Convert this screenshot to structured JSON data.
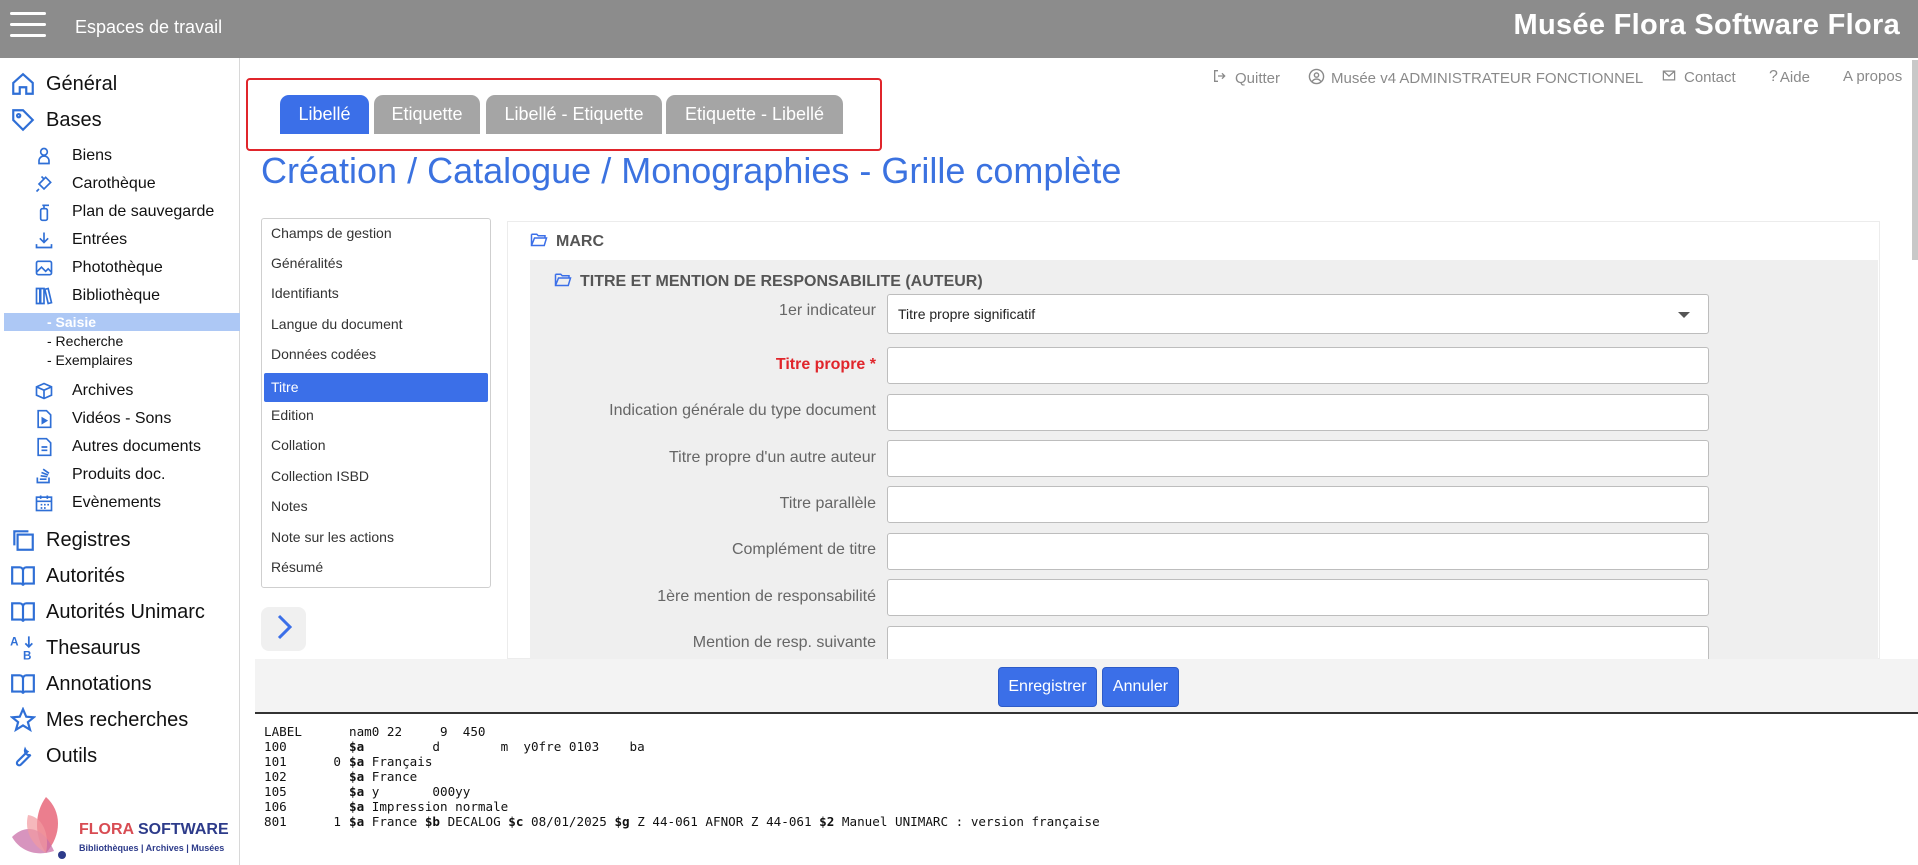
{
  "topbar": {
    "workspaces_label": "Espaces de travail",
    "app_title": "Musée Flora Software Flora"
  },
  "sidebar": {
    "main_items": [
      {
        "label": "Général",
        "icon": "home-icon"
      },
      {
        "label": "Bases",
        "icon": "tag-icon"
      },
      {
        "label": "Registres",
        "icon": "stack-icon"
      },
      {
        "label": "Autorités",
        "icon": "book-icon"
      },
      {
        "label": "Autorités Unimarc",
        "icon": "book-icon"
      },
      {
        "label": "Thesaurus",
        "icon": "az-sort-icon"
      },
      {
        "label": "Annotations",
        "icon": "book-icon"
      },
      {
        "label": "Mes recherches",
        "icon": "star-icon"
      },
      {
        "label": "Outils",
        "icon": "wrench-icon"
      }
    ],
    "sub_items": [
      {
        "label": "Biens",
        "icon": "bust-icon"
      },
      {
        "label": "Carothèque",
        "icon": "drill-icon"
      },
      {
        "label": "Plan de sauvegarde",
        "icon": "extinguisher-icon"
      },
      {
        "label": "Entrées",
        "icon": "download-icon"
      },
      {
        "label": "Photothèque",
        "icon": "image-icon"
      },
      {
        "label": "Bibliothèque",
        "icon": "books-icon"
      },
      {
        "label": "Archives",
        "icon": "box-icon"
      },
      {
        "label": "Vidéos - Sons",
        "icon": "video-file-icon"
      },
      {
        "label": "Autres documents",
        "icon": "document-icon"
      },
      {
        "label": "Produits doc.",
        "icon": "stack-overflow-icon"
      },
      {
        "label": "Evènements",
        "icon": "calendar-icon"
      }
    ],
    "library_leaves": [
      "- Saisie",
      "- Recherche",
      "- Exemplaires"
    ],
    "logo": {
      "brand_a": "FLORA",
      "brand_b": "SOFTWARE",
      "tagline": "Bibliothèques | Archives | Musées"
    }
  },
  "header_links": {
    "quit": "Quitter",
    "user": "Musée v4 ADMINISTRATEUR FONCTIONNEL",
    "contact": "Contact",
    "help": "Aide",
    "about": "A propos"
  },
  "tabs": [
    "Libellé",
    "Etiquette",
    "Libellé - Etiquette",
    "Etiquette - Libellé"
  ],
  "page_title": "Création / Catalogue / Monographies - Grille complète",
  "sections": [
    "Champs de gestion",
    "Généralités",
    "Identifiants",
    "Langue du document",
    "Données codées",
    "Titre",
    "Edition",
    "Collation",
    "Collection ISBD",
    "Notes",
    "Note sur les actions",
    "Résumé"
  ],
  "form": {
    "marc_header": "MARC",
    "section_header": "TITRE ET MENTION DE RESPONSABILITE (AUTEUR)",
    "indicator_label": "1er indicateur",
    "indicator_value": "Titre propre significatif",
    "fields": [
      {
        "label": "Titre propre *",
        "value": ""
      },
      {
        "label": "Indication générale du type document",
        "value": ""
      },
      {
        "label": "Titre propre d'un autre auteur",
        "value": ""
      },
      {
        "label": "Titre parallèle",
        "value": ""
      },
      {
        "label": "Complément de titre",
        "value": ""
      },
      {
        "label": "1ère mention de responsabilité",
        "value": ""
      },
      {
        "label": "Mention de resp. suivante",
        "value": ""
      }
    ]
  },
  "actions": {
    "save": "Enregistrer",
    "cancel": "Annuler"
  },
  "marc_output": [
    {
      "tag": "LABEL",
      "ind": "",
      "content": "nam0 22     9  450"
    },
    {
      "tag": "100",
      "ind": "",
      "content": "$a         d        m  y0fre 0103    ba"
    },
    {
      "tag": "101",
      "ind": "0",
      "content": "$a Français"
    },
    {
      "tag": "102",
      "ind": "",
      "content": "$a France"
    },
    {
      "tag": "105",
      "ind": "",
      "content": "$a y       000yy"
    },
    {
      "tag": "106",
      "ind": "",
      "content": "$a Impression normale"
    },
    {
      "tag": "801",
      "ind": "1",
      "content": "$a France $b DECALOG $c 08/01/2025 $g Z 44-061 AFNOR Z 44-061 $2 Manuel UNIMARC : version française"
    }
  ],
  "colors": {
    "accent": "#3b6fe8",
    "topbar": "#8c8c8c",
    "required": "#e0252b",
    "tab_inactive": "#a5a5a5"
  }
}
